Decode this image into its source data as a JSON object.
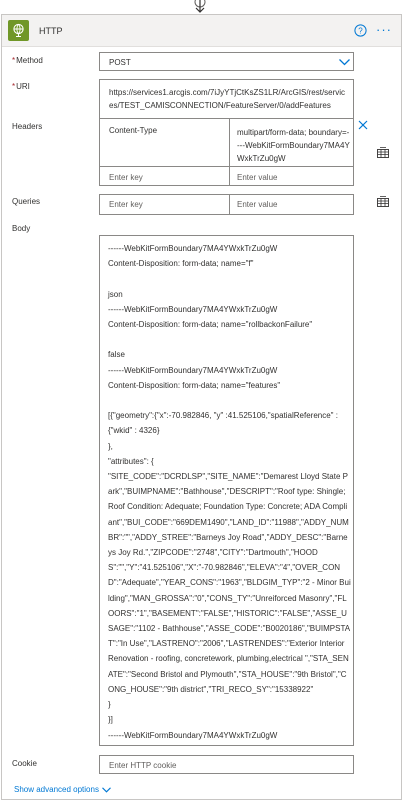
{
  "action": {
    "title": "HTTP",
    "icon": "globe-icon",
    "accent_color": "#709727",
    "link_color": "#0078d4"
  },
  "fields": {
    "method": {
      "label": "Method",
      "required": "*",
      "value": "POST"
    },
    "uri": {
      "label": "URI",
      "required": "*",
      "value": "https://services1.arcgis.com/7iJyYTjCtKsZS1LR/ArcGIS/rest/services/TEST_CAMISCONNECTION/FeatureServer/0/addFeatures"
    },
    "headers": {
      "label": "Headers",
      "rows": [
        {
          "key": "Content-Type",
          "value": "multipart/form-data; boundary=----WebKitFormBoundary7MA4YWxkTrZu0gW"
        }
      ],
      "key_placeholder": "Enter key",
      "value_placeholder": "Enter value"
    },
    "queries": {
      "label": "Queries",
      "key_placeholder": "Enter key",
      "value_placeholder": "Enter value"
    },
    "body": {
      "label": "Body",
      "lines": [
        "------WebKitFormBoundary7MA4YWxkTrZu0gW",
        "Content-Disposition: form-data; name=\"f\"",
        "",
        "json",
        "------WebKitFormBoundary7MA4YWxkTrZu0gW",
        "Content-Disposition: form-data; name=\"rollbackonFailure\"",
        "",
        "false",
        "------WebKitFormBoundary7MA4YWxkTrZu0gW",
        "Content-Disposition: form-data; name=\"features\"",
        "",
        "[{\"geometry\":{\"x\":-70.982846, \"y\" :41.525106,\"spatialReference\" : {\"wkid\" : 4326}",
        "},",
        "\"attributes\": {",
        "\"SITE_CODE\":\"DCRDLSP\",\"SITE_NAME\":\"Demarest Lloyd State Park\",\"BUIMPNAME\":\"Bathhouse\",\"DESCRIPT\":\"Roof type: Shingle; Roof Condition: Adequate; Foundation Type: Concrete; ADA Compliant\",\"BUI_CODE\":\"669DEM1490\",\"LAND_ID\":\"11988\",\"ADDY_NUMBR\":\"\",\"ADDY_STREE\":\"Barneys Joy Road\",\"ADDY_DESC\":\"Barneys Joy Rd.\",\"ZIPCODE\":\"2748\",\"CITY\":\"Dartmouth\",\"HOODS\":\"\",\"Y\":\"41.525106\",\"X\":\"-70.982846\",\"ELEVA\":\"4\",\"OVER_COND\":\"Adequate\",\"YEAR_CONS\":\"1963\",\"BLDGIM_TYP\":\"2 - Minor Building\",\"MAN_GROSSA\":\"0\",\"CONS_TY\":\"Unreiforced Masonry\",\"FLOORS\":\"1\",\"BASEMENT\":\"FALSE\",\"HISTORIC\":\"FALSE\",\"ASSE_USAGE\":\"1102 - Bathhouse\",\"ASSE_CODE\":\"B0020186\",\"BUIMPSTAT\":\"In Use\",\"LASTRENO\":\"2006\",\"LASTRENDES\":\"Exterior Interior Renovation - roofing, concretework, plumbing,electrical \",\"STA_SENATE\":\"Second Bristol and Plymouth\",\"STA_HOUSE\":\"9th Bristol\",\"CONG_HOUSE\":\"9th district\",\"TRI_RECO_SY\":\"15338922\"",
        "}",
        "}]",
        "------WebKitFormBoundary7MA4YWxkTrZu0gW"
      ]
    },
    "cookie": {
      "label": "Cookie",
      "placeholder": "Enter HTTP cookie"
    }
  },
  "footer": {
    "advanced_label": "Show advanced options"
  }
}
